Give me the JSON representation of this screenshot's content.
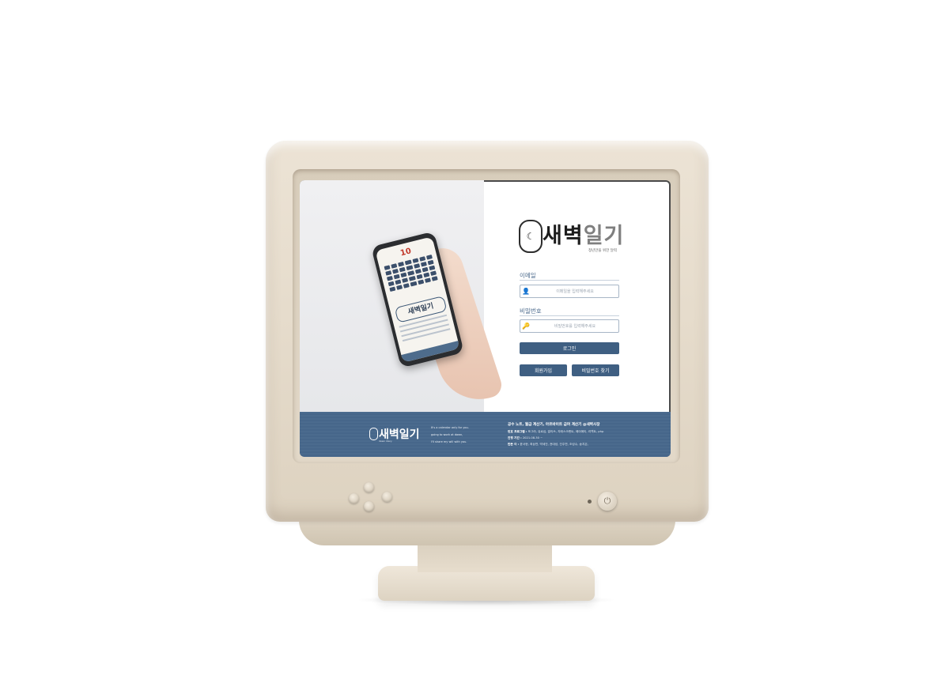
{
  "login_page": {
    "brand": {
      "title_dark": "새벽",
      "title_light": "일기",
      "subtitle": "청년만을 위한 달력"
    },
    "phone_mock": {
      "month": "10",
      "logo_text": "새벽일기"
    },
    "email": {
      "label": "이메일",
      "placeholder": "이메일을 입력해주세요"
    },
    "password": {
      "label": "비밀번호",
      "placeholder": "비밀번호를 입력해주세요"
    },
    "login_button": "로그인",
    "signup_button": "회원가입",
    "find_password_button": "비밀번호 찾기"
  },
  "footer": {
    "logo_text": "새벽일기",
    "logo_sub": "dawn diary",
    "tagline": [
      "It's a calendar only for you.",
      "going to work at dawn,",
      "I'll share my will with you."
    ],
    "headline": "공수 노트, 월급 계산기, 아르바이트 급여 계산기 @새벽사장",
    "rows": [
      {
        "label": "번호 프로그램 :",
        "value": "포그라, 유로십, 알리쓰, 지에스크랜트, 에이에티, 리액트, php"
      },
      {
        "label": "진행 기간 :",
        "value": "2021.08.30 ~"
      },
      {
        "label": "만든 이 :",
        "value": "윤서현, 최상연, 박세진, 권대성, 진주연, 조성수, 송지은,"
      }
    ]
  }
}
